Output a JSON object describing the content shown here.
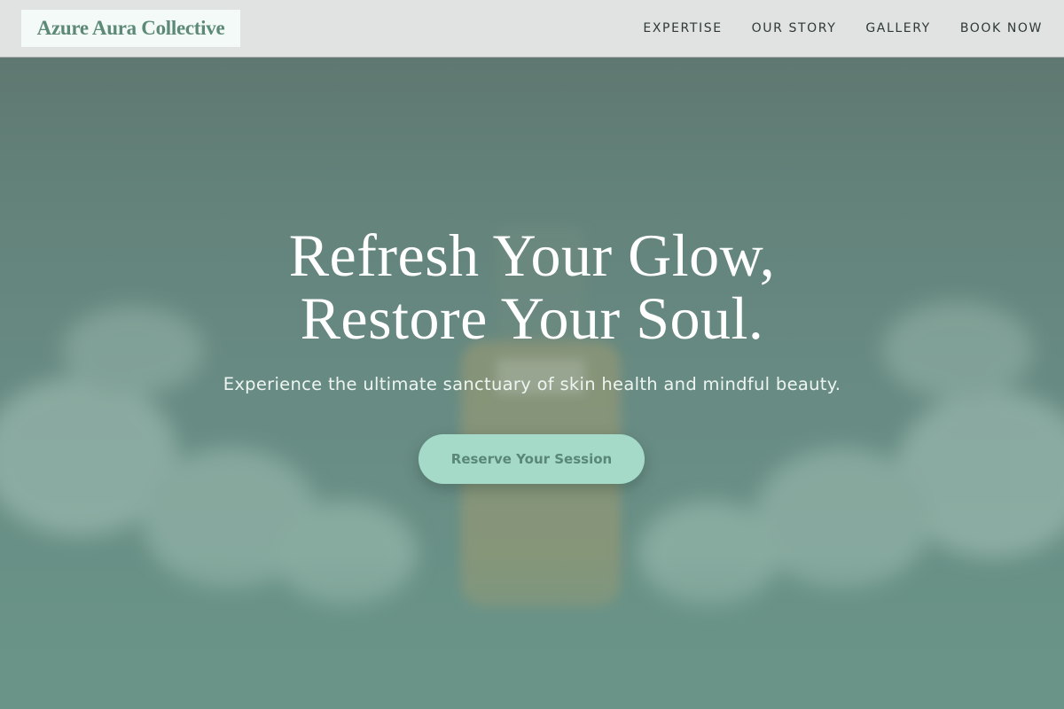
{
  "brand": {
    "name": "Azure Aura Collective"
  },
  "nav": {
    "items": [
      {
        "label": "EXPERTISE"
      },
      {
        "label": "OUR STORY"
      },
      {
        "label": "GALLERY"
      },
      {
        "label": "BOOK NOW"
      }
    ]
  },
  "hero": {
    "headline_line1": "Refresh Your Glow,",
    "headline_line2": "Restore Your Soul.",
    "subtitle": "Experience the ultimate sanctuary of skin health and mindful beauty.",
    "cta_label": "Reserve Your Session"
  },
  "colors": {
    "header_bg": "#e1e3e2",
    "brand_text": "#5c8a77",
    "hero_overlay": "#6a9488",
    "cta_bg": "#a5dac8",
    "cta_text": "#5a8777"
  }
}
